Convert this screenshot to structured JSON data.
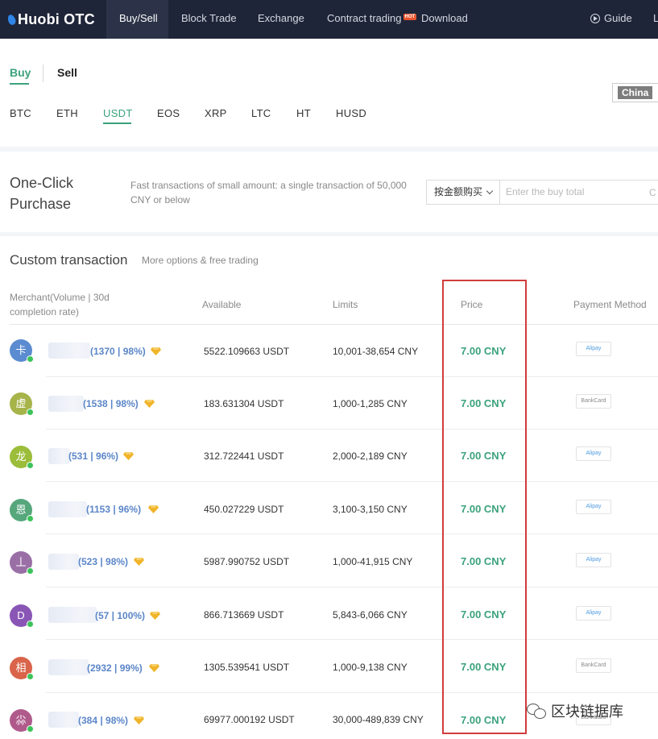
{
  "nav": {
    "brand": "Huobi OTC",
    "items": [
      {
        "label": "Buy/Sell",
        "active": true
      },
      {
        "label": "Block Trade",
        "active": false
      },
      {
        "label": "Exchange",
        "active": false
      },
      {
        "label": "Contract trading",
        "active": false,
        "badge": "HOT"
      },
      {
        "label": "Download",
        "active": false
      }
    ],
    "guide": "Guide",
    "cut": "L"
  },
  "trade_tabs": {
    "buy": "Buy",
    "sell": "Sell",
    "active": "Buy"
  },
  "country": "China",
  "coins": [
    "BTC",
    "ETH",
    "USDT",
    "EOS",
    "XRP",
    "LTC",
    "HT",
    "HUSD"
  ],
  "active_coin": "USDT",
  "one_click": {
    "title": "One-Click Purchase",
    "description": "Fast transactions of small amount: a single transaction of 50,000 CNY or below",
    "mode": "按金额购买",
    "input_placeholder": "Enter the buy total",
    "input_suffix": "C"
  },
  "custom": {
    "title": "Custom transaction",
    "subtitle": "More options & free trading"
  },
  "table": {
    "headers": {
      "merchant": "Merchant(Volume | 30d completion rate)",
      "available": "Available",
      "limits": "Limits",
      "price": "Price",
      "payment": "Payment Method"
    },
    "rows": [
      {
        "avatar": "卡",
        "avatar_color": "#5b8bd0",
        "stats": "(1370 | 98%)",
        "available": "5522.109663 USDT",
        "limits": "10,001-38,654 CNY",
        "price": "7.00 CNY",
        "payment": "Alipay"
      },
      {
        "avatar": "虚",
        "avatar_color": "#a6b44a",
        "stats": "(1538 | 98%)",
        "available": "183.631304 USDT",
        "limits": "1,000-1,285 CNY",
        "price": "7.00 CNY",
        "payment": "BankCard"
      },
      {
        "avatar": "龙",
        "avatar_color": "#9bbd3a",
        "stats": "(531 | 96%)",
        "available": "312.722441 USDT",
        "limits": "2,000-2,189 CNY",
        "price": "7.00 CNY",
        "payment": "Alipay"
      },
      {
        "avatar": "恩",
        "avatar_color": "#56a77c",
        "stats": "(1153 | 96%)",
        "available": "450.027229 USDT",
        "limits": "3,100-3,150 CNY",
        "price": "7.00 CNY",
        "payment": "Alipay"
      },
      {
        "avatar": "丄",
        "avatar_color": "#9a6fa6",
        "stats": "(523 | 98%)",
        "available": "5987.990752 USDT",
        "limits": "1,000-41,915 CNY",
        "price": "7.00 CNY",
        "payment": "Alipay"
      },
      {
        "avatar": "D",
        "avatar_color": "#8a56b6",
        "stats": "(57 | 100%)",
        "available": "866.713669 USDT",
        "limits": "5,843-6,066 CNY",
        "price": "7.00 CNY",
        "payment": "Alipay"
      },
      {
        "avatar": "相",
        "avatar_color": "#d9644a",
        "stats": "(2932 | 99%)",
        "available": "1305.539541 USDT",
        "limits": "1,000-9,138 CNY",
        "price": "7.00 CNY",
        "payment": "BankCard"
      },
      {
        "avatar": "尛",
        "avatar_color": "#b05a8c",
        "stats": "(384 | 98%)",
        "available": "69977.000192 USDT",
        "limits": "30,000-489,839 CNY",
        "price": "7.00 CNY",
        "payment": "BankCard"
      }
    ]
  },
  "watermark": "区块链据库",
  "colors": {
    "accent": "#3ba27c",
    "nav_bg": "#1f2538",
    "merchant_link": "#5b86c8",
    "highlight_box": "#d13d3d",
    "vip_diamond": "#f0b429"
  }
}
